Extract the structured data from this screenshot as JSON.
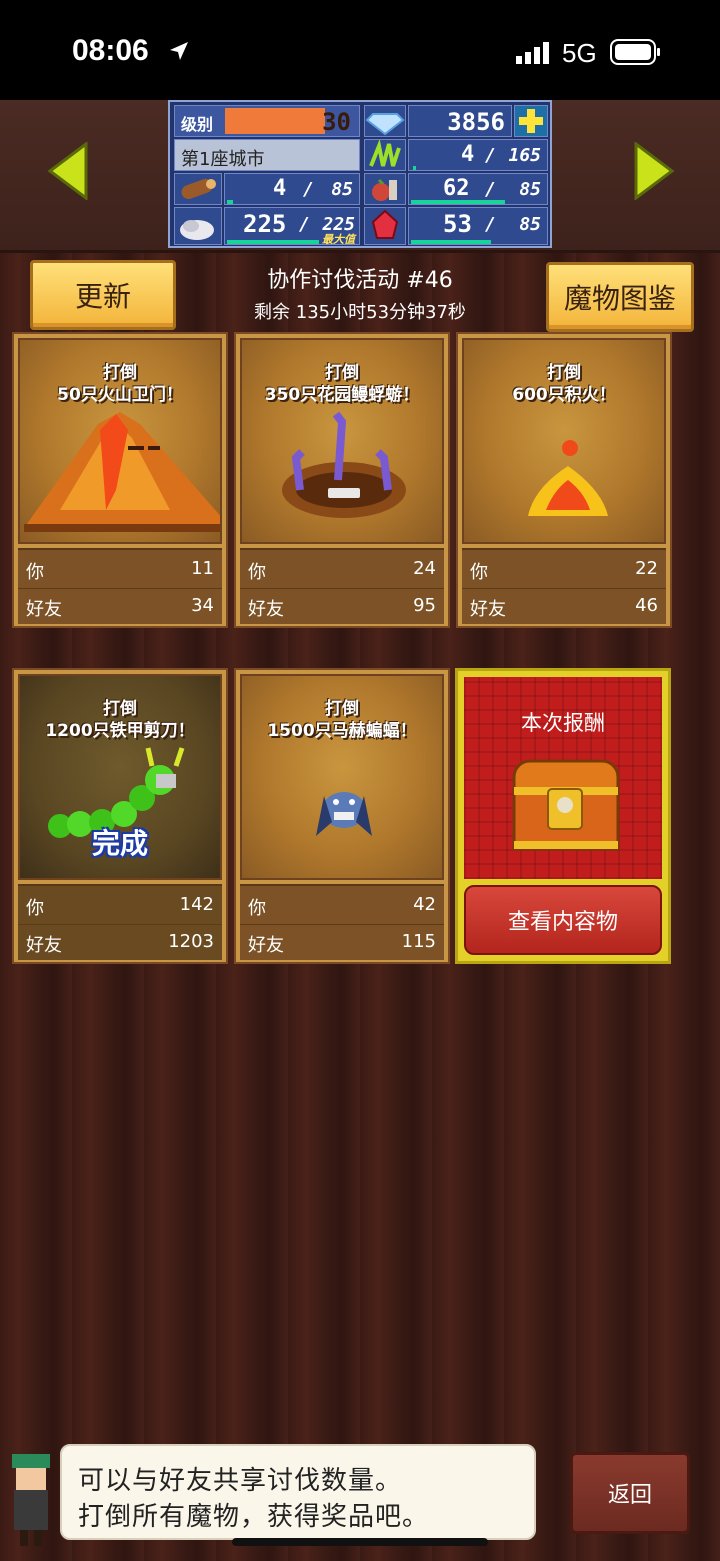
{
  "status_bar": {
    "time": "08:06",
    "network": "5G"
  },
  "stats": {
    "level_label": "级别",
    "level_value": "30",
    "gems": "3856",
    "city_name": "第1座城市",
    "res1_value": "4",
    "res1_max": "165",
    "wood_value": "4",
    "wood_max": "85",
    "food_value": "62",
    "food_max": "85",
    "stone_value": "225",
    "stone_max": "225",
    "stone_max_label": "最大值",
    "ruby_value": "53",
    "ruby_max": "85",
    "sep": "/"
  },
  "header": {
    "update_label": "更新",
    "event_title": "协作讨伐活动 #46",
    "remaining": "剩余 135小时53分钟37秒",
    "dex_label": "魔物图鉴"
  },
  "cards": [
    {
      "l1": "打倒",
      "l2": "50只火山卫门！",
      "you_label": "你",
      "you": "11",
      "friend_label": "好友",
      "friend": "34"
    },
    {
      "l1": "打倒",
      "l2": "350只花园鳗蜉蝣！",
      "you_label": "你",
      "you": "24",
      "friend_label": "好友",
      "friend": "95"
    },
    {
      "l1": "打倒",
      "l2": "600只积火！",
      "you_label": "你",
      "you": "22",
      "friend_label": "好友",
      "friend": "46"
    },
    {
      "l1": "打倒",
      "l2": "1200只铁甲剪刀！",
      "done": "完成",
      "you_label": "你",
      "you": "142",
      "friend_label": "好友",
      "friend": "1203"
    },
    {
      "l1": "打倒",
      "l2": "1500只马赫蝙蝠！",
      "you_label": "你",
      "you": "42",
      "friend_label": "好友",
      "friend": "115"
    }
  ],
  "reward": {
    "title": "本次报酬",
    "button": "查看内容物"
  },
  "message": {
    "line1": "可以与好友共享讨伐数量。",
    "line2": "打倒所有魔物，获得奖品吧。"
  },
  "back_label": "返回",
  "colors": {
    "gold": "#f3b43a",
    "card": "#c99646",
    "panel": "#23346b",
    "reward": "#c21d1d"
  }
}
